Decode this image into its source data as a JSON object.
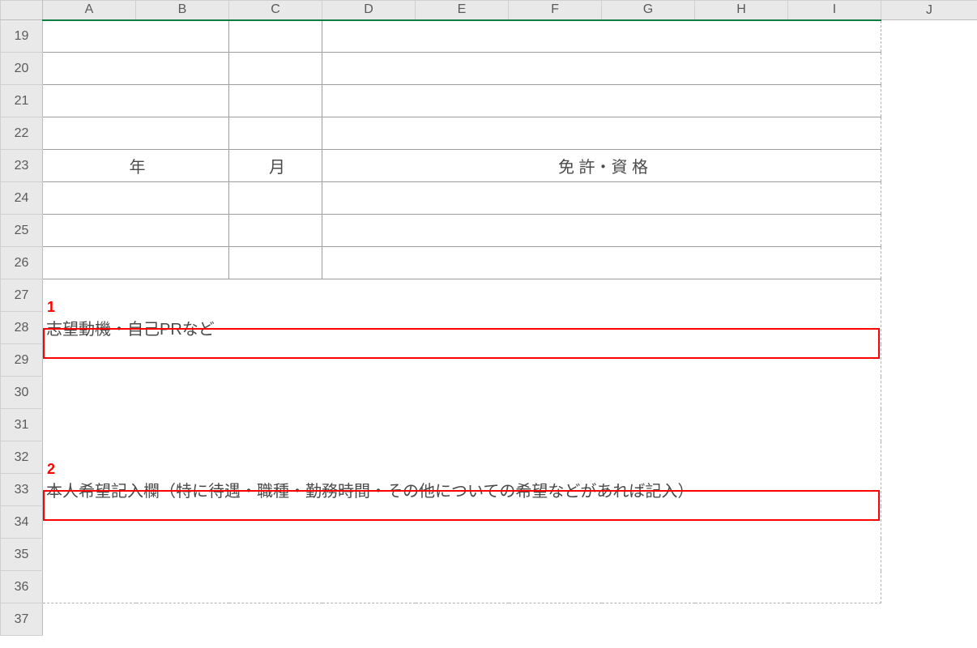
{
  "columns": [
    "A",
    "B",
    "C",
    "D",
    "E",
    "F",
    "G",
    "H",
    "I",
    "J"
  ],
  "rows": [
    "19",
    "20",
    "21",
    "22",
    "23",
    "24",
    "25",
    "26",
    "27",
    "28",
    "29",
    "30",
    "31",
    "32",
    "33",
    "34",
    "35",
    "36",
    "37"
  ],
  "headers": {
    "row23_year": "年",
    "row23_month": "月",
    "row23_license": "免 許・資 格"
  },
  "row28_text": "志望動機・自己PRなど",
  "row33_text": "本人希望記入欄（特に待遇・職種・勤務時間・その他についての希望などがあれば記入）",
  "annotations": {
    "num1": "1",
    "num2": "2"
  }
}
